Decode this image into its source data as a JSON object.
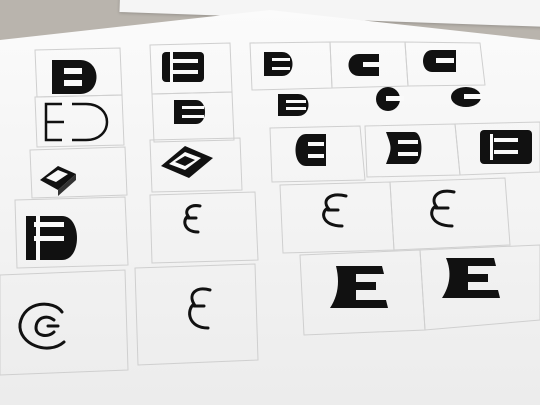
{
  "scene": {
    "description_free": true
  },
  "glyphs": [
    {
      "row": 0,
      "col": 0,
      "char": "E"
    },
    {
      "row": 0,
      "col": 1,
      "char": "E"
    },
    {
      "row": 0,
      "col": 2,
      "char": "E"
    },
    {
      "row": 0,
      "col": 3,
      "char": "E"
    },
    {
      "row": 0,
      "col": 4,
      "char": "E"
    },
    {
      "row": 1,
      "col": 0,
      "char": "E"
    },
    {
      "row": 1,
      "col": 1,
      "char": "E"
    },
    {
      "row": 1,
      "col": 2,
      "char": "E"
    },
    {
      "row": 1,
      "col": 3,
      "char": "C"
    },
    {
      "row": 1,
      "col": 4,
      "char": "C"
    },
    {
      "row": 2,
      "col": 0,
      "char": "E"
    },
    {
      "row": 2,
      "col": 1,
      "char": "E"
    },
    {
      "row": 2,
      "col": 2,
      "char": "E"
    },
    {
      "row": 2,
      "col": 3,
      "char": "E"
    },
    {
      "row": 2,
      "col": 4,
      "char": "E"
    },
    {
      "row": 3,
      "col": 0,
      "char": "E"
    },
    {
      "row": 3,
      "col": 1,
      "char": "ε"
    },
    {
      "row": 3,
      "col": 2,
      "char": "ε"
    },
    {
      "row": 3,
      "col": 3,
      "char": "ε"
    },
    {
      "row": 4,
      "col": 0,
      "char": "C"
    },
    {
      "row": 4,
      "col": 1,
      "char": "ε"
    },
    {
      "row": 4,
      "col": 2,
      "char": "E"
    },
    {
      "row": 4,
      "col": 3,
      "char": "E"
    }
  ],
  "colors": {
    "ink": "#111111",
    "paper": "#f6f6f6",
    "background": "#b9b4ad"
  }
}
